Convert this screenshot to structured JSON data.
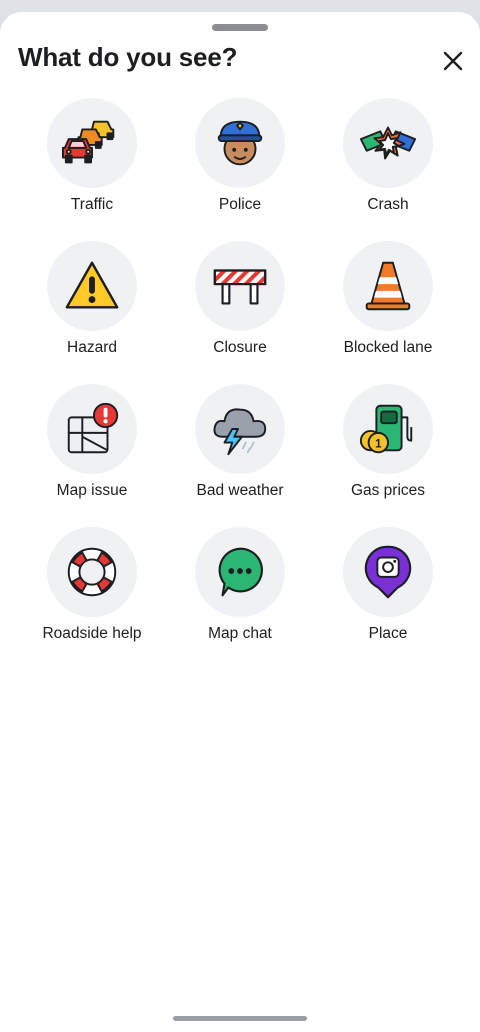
{
  "sheet": {
    "title": "What do you see?",
    "close_icon": "close-icon"
  },
  "options": [
    {
      "label": "Traffic",
      "icon": "traffic-icon"
    },
    {
      "label": "Police",
      "icon": "police-icon"
    },
    {
      "label": "Crash",
      "icon": "crash-icon"
    },
    {
      "label": "Hazard",
      "icon": "hazard-icon"
    },
    {
      "label": "Closure",
      "icon": "closure-icon"
    },
    {
      "label": "Blocked lane",
      "icon": "blocked-lane-icon"
    },
    {
      "label": "Map issue",
      "icon": "map-issue-icon"
    },
    {
      "label": "Bad weather",
      "icon": "bad-weather-icon"
    },
    {
      "label": "Gas prices",
      "icon": "gas-prices-icon"
    },
    {
      "label": "Roadside help",
      "icon": "roadside-help-icon"
    },
    {
      "label": "Map chat",
      "icon": "map-chat-icon"
    },
    {
      "label": "Place",
      "icon": "place-icon"
    }
  ],
  "colors": {
    "tile_background": "#eff1f5",
    "text": "#1c1e21"
  }
}
